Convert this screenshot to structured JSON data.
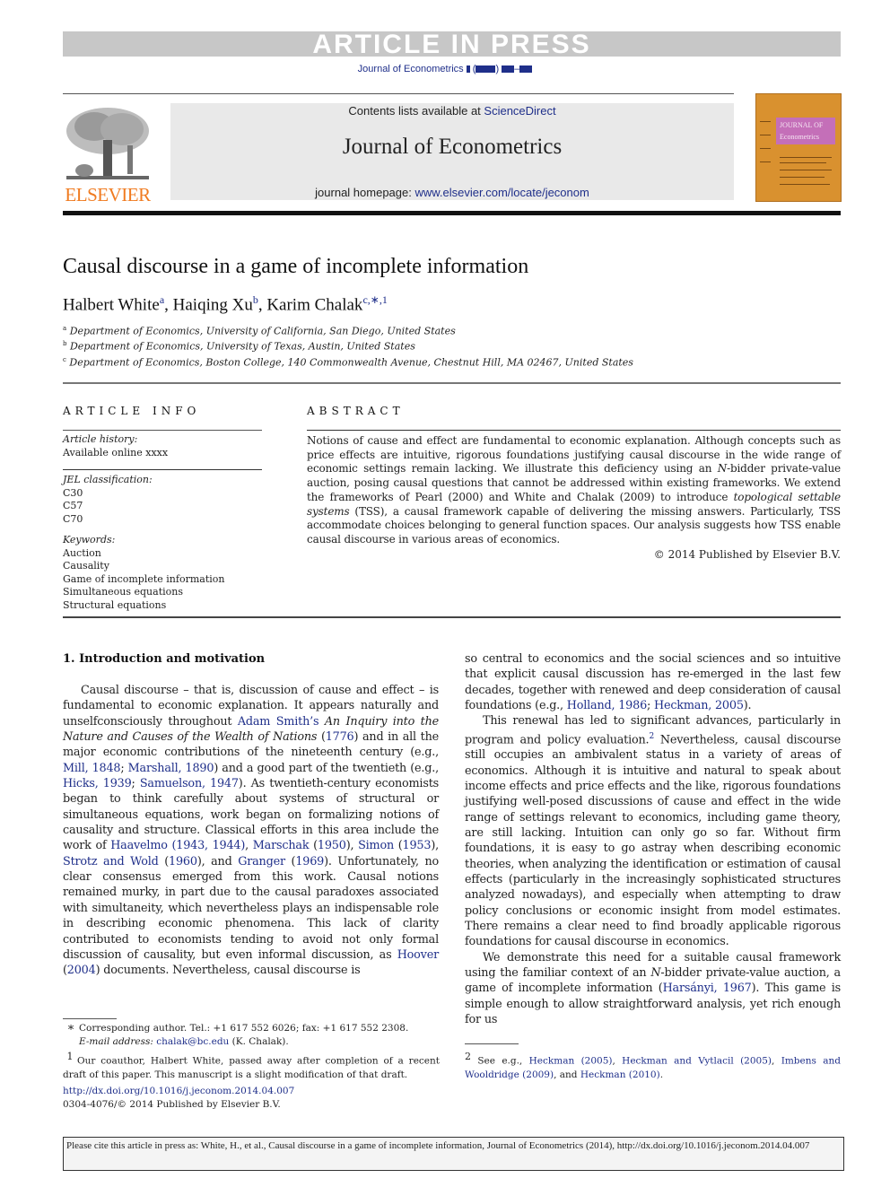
{
  "banner": {
    "text": "ARTICLE IN PRESS",
    "journal_ref": "Journal of Econometrics"
  },
  "masthead": {
    "publisher": "ELSEVIER",
    "contents_prefix": "Contents lists available at ",
    "contents_link": "ScienceDirect",
    "journal_title": "Journal of Econometrics",
    "homepage_prefix": "journal homepage: ",
    "homepage_link": "www.elsevier.com/locate/jeconom",
    "cover_title_1": "JOURNAL OF",
    "cover_title_2": "Econometrics"
  },
  "article": {
    "title": "Causal discourse in a game of incomplete information",
    "authors": [
      {
        "name": "Halbert White",
        "sup": "a"
      },
      {
        "name": "Haiqing Xu",
        "sup": "b"
      },
      {
        "name": "Karim Chalak",
        "sup": "c,∗,1"
      }
    ],
    "affiliations": [
      {
        "mark": "a",
        "text": "Department of Economics, University of California, San Diego, United States"
      },
      {
        "mark": "b",
        "text": "Department of Economics, University of Texas, Austin, United States"
      },
      {
        "mark": "c",
        "text": "Department of Economics, Boston College, 140 Commonwealth Avenue, Chestnut Hill, MA 02467, United States"
      }
    ]
  },
  "article_info": {
    "heading": "ARTICLE INFO",
    "history_label": "Article history:",
    "history_value": "Available online xxxx",
    "jel_label": "JEL classification:",
    "jel_codes": [
      "C30",
      "C57",
      "C70"
    ],
    "keywords_label": "Keywords:",
    "keywords": [
      "Auction",
      "Causality",
      "Game of incomplete information",
      "Simultaneous equations",
      "Structural equations"
    ]
  },
  "abstract": {
    "heading": "ABSTRACT",
    "p1": "Notions of cause and effect are fundamental to economic explanation. Although concepts such as price effects are intuitive, rigorous foundations justifying causal discourse in the wide range of economic settings remain lacking. We illustrate this deficiency using an ",
    "p1_italic": "N",
    "p2": "-bidder private-value auction, posing causal questions that cannot be addressed within existing frameworks. We extend the frameworks of Pearl (2000) and White and Chalak (2009) to introduce ",
    "p2_italic": "topological settable systems",
    "p3": " (TSS), a causal framework capable of delivering the missing answers. Particularly, TSS accommodate choices belonging to general function spaces. Our analysis suggests how TSS enable causal discourse in various areas of economics.",
    "copyright": "© 2014 Published by Elsevier B.V."
  },
  "section1": {
    "heading": "1.  Introduction and motivation",
    "left": {
      "t1": "Causal discourse – that is, discussion of cause and effect – is fundamental to economic explanation. It appears naturally and unselfconsciously throughout ",
      "l1": "Adam Smith’s",
      "t2": " ",
      "i1": "An Inquiry into the Nature and Causes of the Wealth of Nations",
      "t3": " (",
      "l2": "1776",
      "t4": ") and in all the major economic contributions of the nineteenth century (e.g., ",
      "l3": "Mill, 1848",
      "t5": "; ",
      "l4": "Marshall, 1890",
      "t6": ") and a good part of the twentieth (e.g., ",
      "l5": "Hicks, 1939",
      "t7": "; ",
      "l6": "Samuelson, 1947",
      "t8": "). As twentieth-century economists began to think carefully about systems of structural or simultaneous equations, work began on formalizing notions of causality and structure. Classical efforts in this area include the work of ",
      "l7": "Haavelmo (1943, 1944)",
      "t9": ", ",
      "l8": "Marschak",
      "t10": " (",
      "l9": "1950",
      "t11": "), ",
      "l10": "Simon",
      "t12": " (",
      "l11": "1953",
      "t13": "), ",
      "l12": "Strotz and Wold",
      "t14": " (",
      "l13": "1960",
      "t15": "), and ",
      "l14": "Granger",
      "t16": " (",
      "l15": "1969",
      "t17": "). Unfortunately, no clear consensus emerged from this work. Causal notions remained murky, in part due to the causal paradoxes associated with simultaneity, which nevertheless plays an indispensable role in describing economic phenomena. This lack of clarity contributed to economists tending to avoid not only formal discussion of causality, but even informal discussion, as ",
      "l16": "Hoover",
      "t18": " (",
      "l17": "2004",
      "t19": ") documents. Nevertheless, causal discourse is"
    },
    "right": {
      "a1": "so central to economics and the social sciences and so intuitive that explicit causal discussion has re-emerged in the last few decades, together with renewed and deep consideration of causal foundations (e.g., ",
      "al1": "Holland, 1986",
      "a2": "; ",
      "al2": "Heckman, 2005",
      "a3": ").",
      "b1": "This renewal has led to significant advances, particularly in program and policy evaluation.",
      "b_fn": "2",
      "b2": " Nevertheless, causal discourse still occupies an ambivalent status in a variety of areas of economics. Although it is intuitive and natural to speak about income effects and price effects and the like, rigorous foundations justifying well-posed discussions of cause and effect in the wide range of settings relevant to economics, including game theory, are still lacking. Intuition can only go so far. Without firm foundations, it is easy to go astray when describing economic theories, when analyzing the identification or estimation of causal effects (particularly in the increasingly sophisticated structures analyzed nowadays), and especially when attempting to draw policy conclusions or economic insight from model estimates. There remains a clear need to find broadly applicable rigorous foundations for causal discourse in economics.",
      "c1": "We demonstrate this need for a suitable causal framework using the familiar context of an ",
      "c_i": "N",
      "c2": "-bidder private-value auction, a game of incomplete information (",
      "cl1": "Harsányi, 1967",
      "c3": "). This game is simple enough to allow straightforward analysis, yet rich enough for us"
    }
  },
  "footnotes": {
    "star_mark": "∗",
    "star_text": "Corresponding author. Tel.: +1 617 552 6026; fax: +1 617 552 2308.",
    "email_label": "E-mail address: ",
    "email": "chalak@bc.edu",
    "email_suffix": " (K. Chalak).",
    "fn1_mark": "1",
    "fn1_text": "Our coauthor, Halbert White, passed away after completion of a recent draft of this paper. This manuscript is a slight modification of that draft.",
    "doi": "http://dx.doi.org/10.1016/j.jeconom.2014.04.007",
    "issn": "0304-4076/© 2014 Published by Elsevier B.V.",
    "fn2_mark": "2",
    "fn2_t1": " See e.g., ",
    "fn2_l1": "Heckman (2005)",
    "fn2_t2": ", ",
    "fn2_l2": "Heckman and Vytlacil (2005)",
    "fn2_t3": ", ",
    "fn2_l3": "Imbens and Wooldridge (2009)",
    "fn2_t4": ", and ",
    "fn2_l4": "Heckman (2010)",
    "fn2_t5": "."
  },
  "cite_box": {
    "text": "Please cite this article in press as: White, H., et al., Causal discourse in a game of incomplete information, Journal of Econometrics (2014), http://dx.doi.org/10.1016/j.jeconom.2014.04.007"
  },
  "colors": {
    "link": "#1f2f8a",
    "elsevier_orange": "#f07b20",
    "banner_gray": "#c7c7c7"
  }
}
